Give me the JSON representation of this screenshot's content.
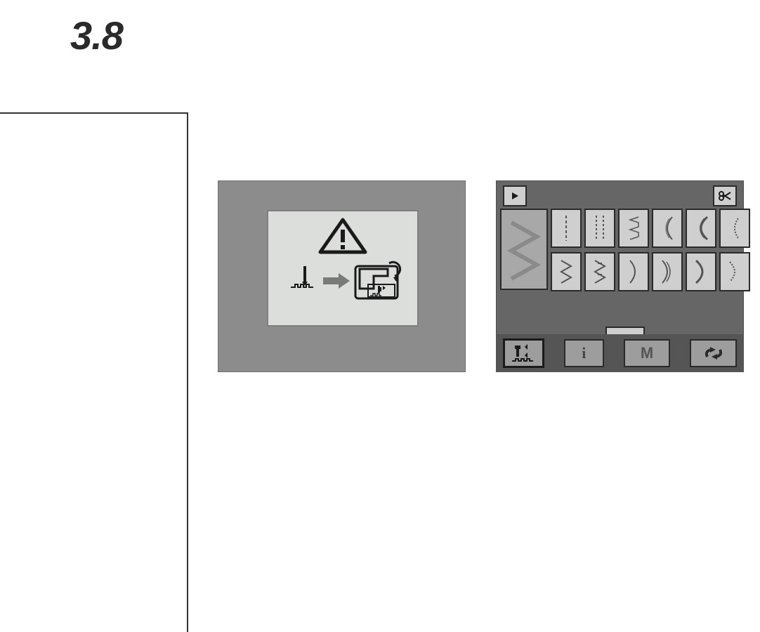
{
  "section": {
    "number": "3.8"
  },
  "screen_left": {
    "dialog": {
      "icon_top": "warning-triangle",
      "flow": {
        "from": "needle-with-feed-icon",
        "arrow": "arrow-right",
        "to": "tilt-machine-icon"
      }
    }
  },
  "screen_right": {
    "topbar": {
      "left_btn_icon": "play-triangle",
      "right_btn_icon": "scissors"
    },
    "selected_stitch_icon": "wide-zigzag",
    "row1": [
      "straight-stitch",
      "triple-stretch",
      "blindstitch-left",
      "blindstitch-double",
      "blindstitch-heavy",
      "arc-narrow"
    ],
    "row2": [
      "zigzag",
      "reinforced-zigzag",
      "curve-right",
      "curve-double",
      "curve-heavy",
      "curve-wide"
    ],
    "next_btn_icon": "play-triangle",
    "bottom_bar": {
      "buttons": [
        {
          "name": "needle-position-button",
          "icon": "needle-updown",
          "selected": true,
          "label": ""
        },
        {
          "name": "info-button",
          "icon": "",
          "selected": false,
          "label": "i"
        },
        {
          "name": "menu-button",
          "icon": "",
          "selected": false,
          "label": "M"
        },
        {
          "name": "cycle-button",
          "icon": "cycle-arrows",
          "selected": false,
          "label": ""
        }
      ]
    }
  }
}
